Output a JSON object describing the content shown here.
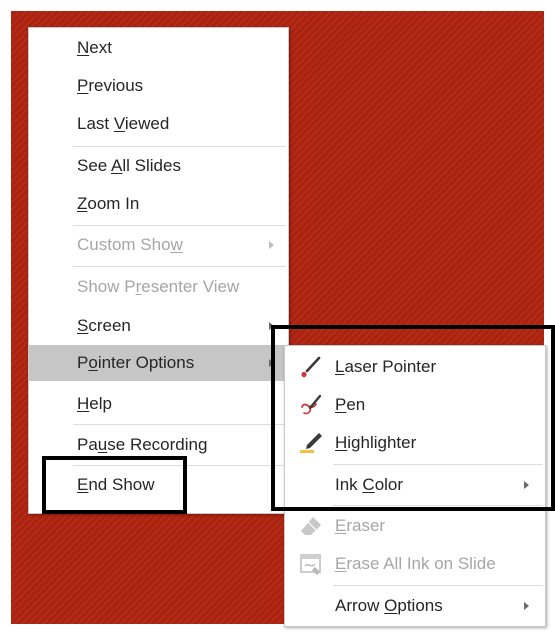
{
  "main_menu": {
    "items": [
      {
        "pre": "",
        "key": "N",
        "post": "ext"
      },
      {
        "pre": "",
        "key": "P",
        "post": "revious"
      },
      {
        "pre": "Last ",
        "key": "V",
        "post": "iewed"
      },
      {
        "pre": "See ",
        "key": "A",
        "post": "ll Slides"
      },
      {
        "pre": "",
        "key": "Z",
        "post": "oom In"
      },
      {
        "pre": "Custom Sho",
        "key": "w",
        "post": ""
      },
      {
        "pre": "Show P",
        "key": "r",
        "post": "esenter View"
      },
      {
        "pre": "",
        "key": "S",
        "post": "creen"
      },
      {
        "pre": "P",
        "key": "o",
        "post": "inter Options"
      },
      {
        "pre": "",
        "key": "H",
        "post": "elp"
      },
      {
        "pre": "Pa",
        "key": "u",
        "post": "se Recording"
      },
      {
        "pre": "",
        "key": "E",
        "post": "nd Show"
      }
    ]
  },
  "sub_menu": {
    "items": [
      {
        "pre": "",
        "key": "L",
        "post": "aser Pointer"
      },
      {
        "pre": "",
        "key": "P",
        "post": "en"
      },
      {
        "pre": "",
        "key": "H",
        "post": "ighlighter"
      },
      {
        "pre": "Ink ",
        "key": "C",
        "post": "olor"
      },
      {
        "pre": "",
        "key": "E",
        "post": "raser"
      },
      {
        "pre": "",
        "key": "E",
        "post": "rase All Ink on Slide"
      },
      {
        "pre": "Arrow ",
        "key": "O",
        "post": "ptions"
      }
    ]
  },
  "colors": {
    "slide_background": "#b12410",
    "menu_hover": "#c6c6c6",
    "disabled_text": "#a6a6a6",
    "laser_red": "#d13438",
    "highlighter_yellow": "#f2c43d"
  },
  "icons": {
    "laser_pointer": "laser-pointer-icon",
    "pen": "pen-icon",
    "highlighter": "highlighter-icon",
    "eraser": "eraser-icon",
    "erase_all": "erase-all-ink-icon"
  }
}
